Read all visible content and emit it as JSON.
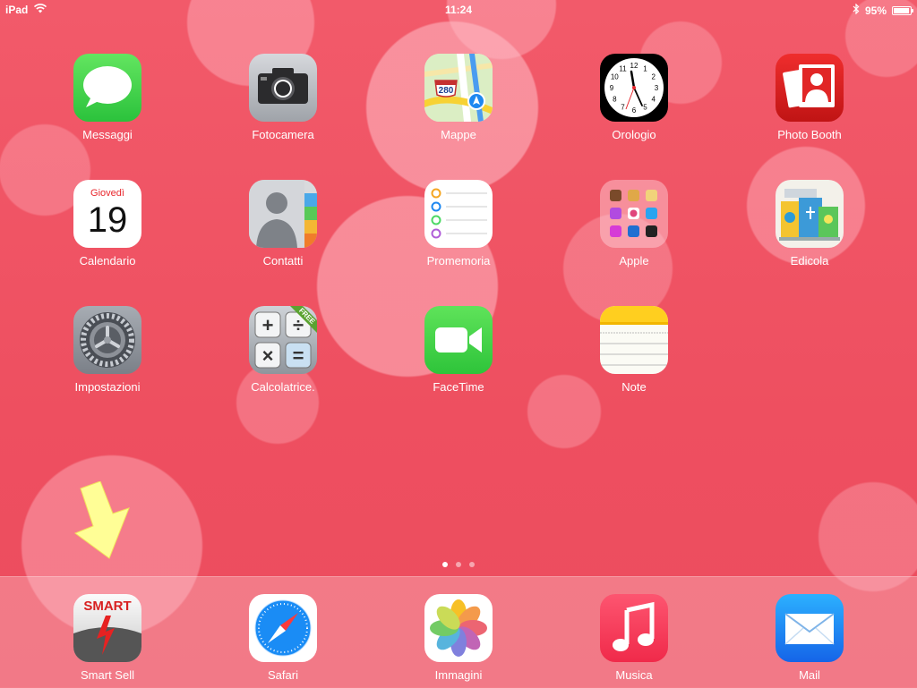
{
  "status_bar": {
    "device": "iPad",
    "time": "11:24",
    "battery": "95%",
    "battery_level": 0.95,
    "icons": [
      "wifi-icon",
      "bluetooth-icon",
      "battery-icon"
    ]
  },
  "apps": [
    {
      "label": "Messaggi",
      "icon": "messages-icon"
    },
    {
      "label": "Fotocamera",
      "icon": "camera-icon"
    },
    {
      "label": "Mappe",
      "icon": "maps-icon",
      "badge_text": "280"
    },
    {
      "label": "Orologio",
      "icon": "clock-icon"
    },
    {
      "label": "Photo Booth",
      "icon": "photo-booth-icon"
    },
    {
      "label": "Calendario",
      "icon": "calendar-icon",
      "day_name": "Giovedì",
      "day_number": "19"
    },
    {
      "label": "Contatti",
      "icon": "contacts-icon"
    },
    {
      "label": "Promemoria",
      "icon": "reminders-icon"
    },
    {
      "label": "Apple",
      "icon": "folder-icon"
    },
    {
      "label": "Edicola",
      "icon": "newsstand-icon"
    },
    {
      "label": "Impostazioni",
      "icon": "settings-gear-icon"
    },
    {
      "label": "Calcolatrice.",
      "icon": "calculator-icon",
      "ribbon": "FREE"
    },
    {
      "label": "FaceTime",
      "icon": "facetime-icon"
    },
    {
      "label": "Note",
      "icon": "notes-icon"
    }
  ],
  "clock_numbers": [
    "12",
    "1",
    "2",
    "3",
    "4",
    "5",
    "6",
    "7",
    "8",
    "9",
    "10",
    "11"
  ],
  "page_indicator": {
    "count": 3,
    "active": 0
  },
  "dock": [
    {
      "label": "Smart Sell",
      "icon": "smart-sell-icon",
      "logo_text": "SMART"
    },
    {
      "label": "Safari",
      "icon": "safari-compass-icon"
    },
    {
      "label": "Immagini",
      "icon": "photos-icon"
    },
    {
      "label": "Musica",
      "icon": "music-note-icon"
    },
    {
      "label": "Mail",
      "icon": "mail-envelope-icon"
    }
  ],
  "colors": {
    "wallpaper": "#ee5262",
    "messages_green": "#4cd964",
    "facetime_green": "#3fd24f",
    "maps_blue": "#1e88f0",
    "photo_booth_red": "#d81d1d",
    "music_red": "#fc3158",
    "mail_blue": "#1a8cf5",
    "notes_yellow": "#ffd021",
    "arrow_yellow": "#fffe96"
  }
}
